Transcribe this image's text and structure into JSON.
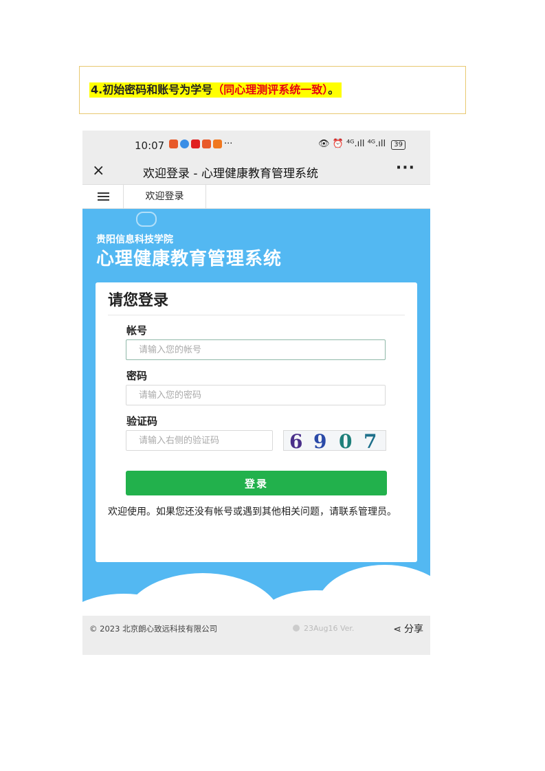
{
  "note": {
    "prefix": "4.初始密码和账号为学号",
    "highlight": "（同心理测评系统一致）",
    "suffix": "。"
  },
  "statusbar": {
    "time": "10:07",
    "dots": "···",
    "signal": "⁴ᴳ.ıll ⁴ᴳ.ıll",
    "battery": "39"
  },
  "titlebar": {
    "title": "欢迎登录 - 心理健康教育管理系统",
    "close_icon": "×",
    "more_icon": "···"
  },
  "tabs": {
    "active": "欢迎登录"
  },
  "hero": {
    "school": "贵阳信息科技学院",
    "system": "心理健康教育管理系统"
  },
  "login": {
    "title": "请您登录",
    "account_label": "帐号",
    "account_placeholder": "请输入您的帐号",
    "password_label": "密码",
    "password_placeholder": "请输入您的密码",
    "captcha_label": "验证码",
    "captcha_placeholder": "请输入右侧的验证码",
    "captcha_code": [
      "6",
      "9",
      "0",
      "7"
    ],
    "button": "登录",
    "help": "欢迎使用。如果您还没有帐号或遇到其他相关问题，请联系管理员。"
  },
  "footer": {
    "copyright": "© 2023 北京朗心致远科技有限公司",
    "version": "23Aug16 Ver.",
    "share": "分享"
  },
  "colors": {
    "hero_bg": "#53b8f2",
    "login_button": "#22b14c",
    "note_highlight_bg": "#ffff00",
    "note_highlight_text": "#e60012"
  }
}
